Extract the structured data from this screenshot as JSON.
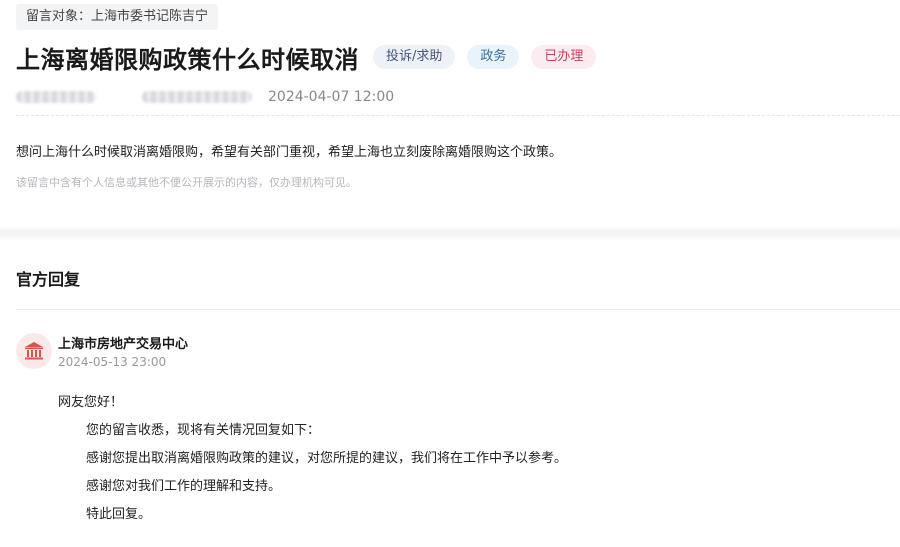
{
  "message": {
    "target_label": "留言对象：",
    "target": "上海市委书记陈吉宁",
    "title": "上海离婚限购政策什么时候取消",
    "tags": [
      {
        "label": "投诉/求助"
      },
      {
        "label": "政务"
      },
      {
        "label": "已办理"
      }
    ],
    "post_time": "2024-04-07 12:00",
    "content": "想问上海什么时候取消离婚限购，希望有关部门重视，希望上海也立刻废除离婚限购这个政策。",
    "privacy_notice": "该留言中含有个人信息或其他不便公开展示的内容，仅办理机构可见。"
  },
  "reply": {
    "section_title": "官方回复",
    "org_icon": "government-building-icon",
    "org_name": "上海市房地产交易中心",
    "time": "2024-05-13 23:00",
    "lines": [
      "网友您好！",
      "您的留言收悉，现将有关情况回复如下：",
      "感谢您提出取消离婚限购政策的建议，对您所提的建议，我们将在工作中予以参考。",
      "感谢您对我们工作的理解和支持。",
      "特此回复。"
    ]
  },
  "colors": {
    "status_tag": "#c5435a",
    "area_tag": "#3a6f98",
    "icon": "#d9534f"
  }
}
